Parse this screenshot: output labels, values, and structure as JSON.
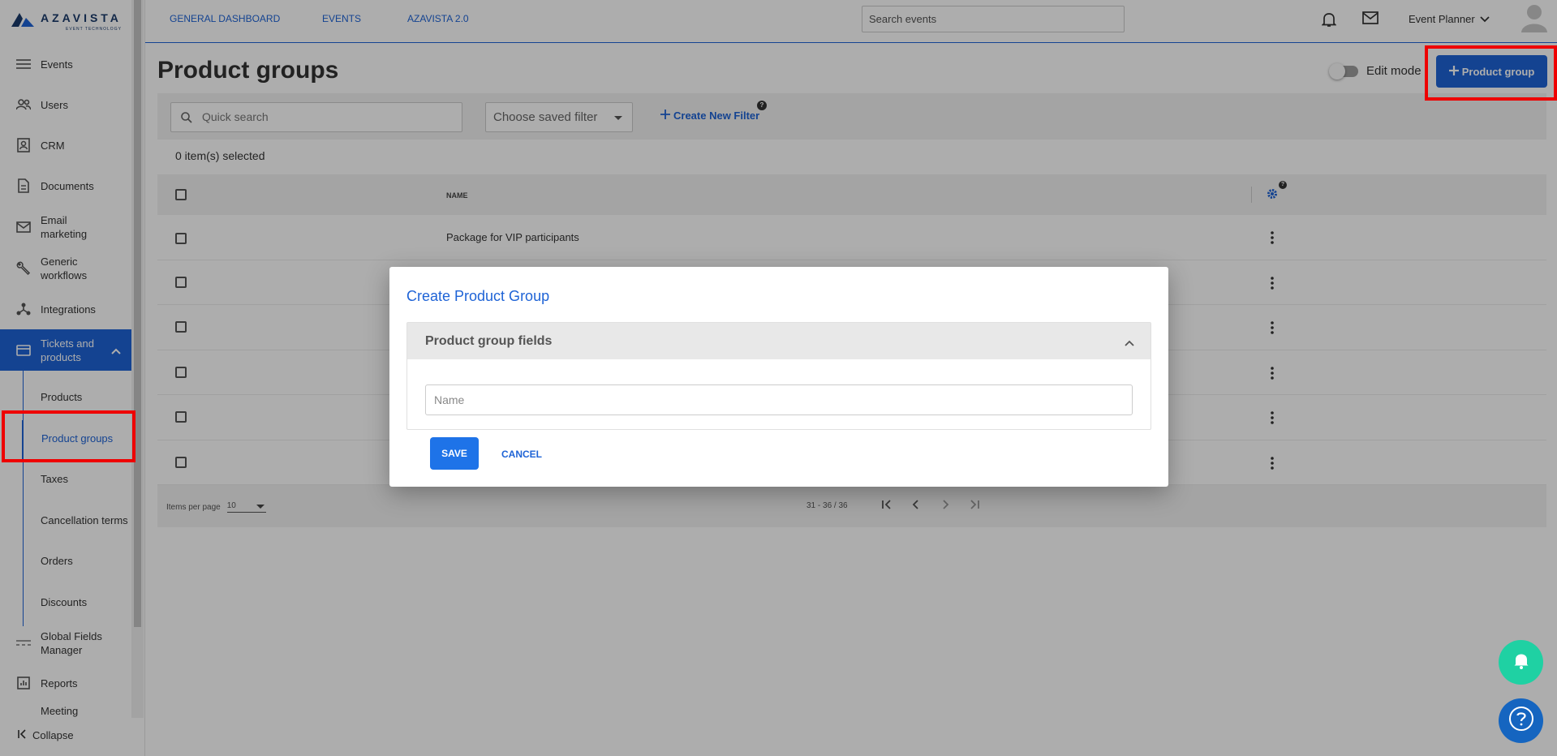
{
  "brand": {
    "name": "AZAVISTA",
    "tagline": "EVENT TECHNOLOGY"
  },
  "sidebar": {
    "items": [
      {
        "label": "Events",
        "icon": "events-icon"
      },
      {
        "label": "Users",
        "icon": "users-icon"
      },
      {
        "label": "CRM",
        "icon": "crm-icon"
      },
      {
        "label": "Documents",
        "icon": "document-icon"
      },
      {
        "label": "Email marketing",
        "icon": "email-icon"
      },
      {
        "label": "Generic workflows",
        "icon": "wrench-icon"
      },
      {
        "label": "Integrations",
        "icon": "integrations-icon"
      },
      {
        "label": "Tickets and products",
        "icon": "ticket-icon"
      },
      {
        "label": "Global Fields Manager",
        "icon": "fields-icon"
      },
      {
        "label": "Reports",
        "icon": "reports-icon"
      },
      {
        "label": "Meeting",
        "icon": "meeting-icon"
      }
    ],
    "subitems": [
      "Products",
      "Product groups",
      "Taxes",
      "Cancellation terms",
      "Orders",
      "Discounts"
    ],
    "collapse_label": "Collapse"
  },
  "topbar": {
    "nav": [
      "GENERAL DASHBOARD",
      "EVENTS",
      "AZAVISTA 2.0"
    ],
    "search_placeholder": "Search events",
    "user_label": "Event Planner"
  },
  "page": {
    "title": "Product groups",
    "edit_mode_label": "Edit mode",
    "add_button_label": "Product group",
    "quick_search_placeholder": "Quick search",
    "saved_filter_placeholder": "Choose saved filter",
    "create_filter_label": "Create New Filter",
    "selected_text": "0 item(s) selected"
  },
  "table": {
    "name_header": "NAME",
    "rows": [
      "Package for VIP participants",
      "",
      "",
      "",
      "",
      ""
    ],
    "items_per_page_label": "Items per page",
    "items_per_page_value": "10",
    "range_text": "31 - 36 / 36"
  },
  "modal": {
    "title": "Create Product Group",
    "section_title": "Product group fields",
    "name_placeholder": "Name",
    "save_label": "SAVE",
    "cancel_label": "CANCEL"
  },
  "colors": {
    "primary": "#1e63d6",
    "accent_green": "#1fd1a3",
    "highlight_red": "#e00000"
  }
}
